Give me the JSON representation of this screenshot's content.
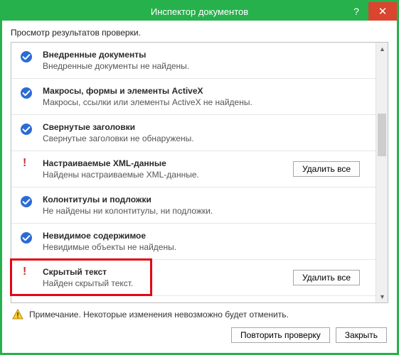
{
  "window": {
    "title": "Инспектор документов"
  },
  "intro": "Просмотр результатов проверки.",
  "sections": [
    {
      "status": "ok",
      "title": "Внедренные документы",
      "desc": "Внедренные документы не найдены."
    },
    {
      "status": "ok",
      "title": "Макросы, формы и элементы ActiveX",
      "desc": "Макросы, ссылки или элементы ActiveX не найдены."
    },
    {
      "status": "ok",
      "title": "Свернутые заголовки",
      "desc": "Свернутые заголовки не обнаружены."
    },
    {
      "status": "warn",
      "title": "Настраиваемые XML-данные",
      "desc": "Найдены настраиваемые XML-данные.",
      "action": "Удалить все"
    },
    {
      "status": "ok",
      "title": "Колонтитулы и подложки",
      "desc": "Не найдены ни колонтитулы, ни подложки."
    },
    {
      "status": "ok",
      "title": "Невидимое содержимое",
      "desc": "Невидимые объекты не найдены."
    },
    {
      "status": "warn",
      "title": "Скрытый текст",
      "desc": "Найден скрытый текст.",
      "action": "Удалить все",
      "highlighted": true
    }
  ],
  "note": "Примечание. Некоторые изменения невозможно будет отменить.",
  "footer": {
    "reinspect": "Повторить проверку",
    "close": "Закрыть"
  }
}
